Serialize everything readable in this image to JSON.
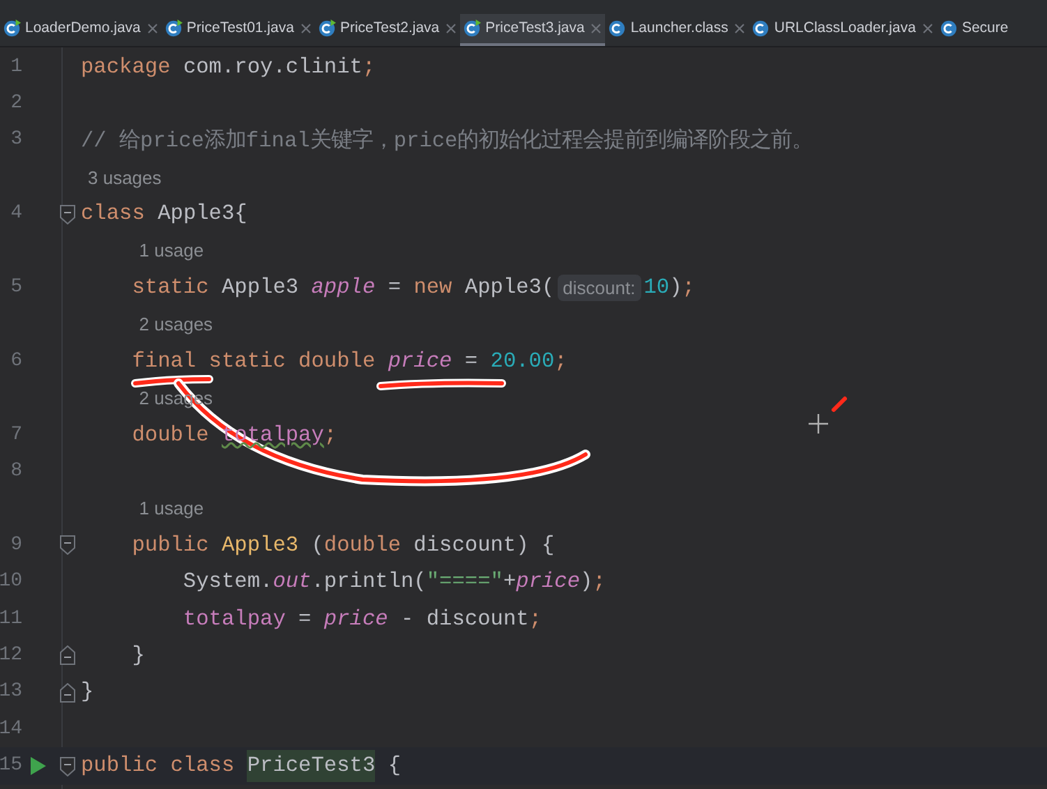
{
  "tabs": [
    {
      "label": "LoaderDemo.java",
      "kind": "runnable",
      "selected": false
    },
    {
      "label": "PriceTest01.java",
      "kind": "runnable",
      "selected": false
    },
    {
      "label": "PriceTest2.java",
      "kind": "runnable",
      "selected": false
    },
    {
      "label": "PriceTest3.java",
      "kind": "runnable",
      "selected": true
    },
    {
      "label": "Launcher.class",
      "kind": "class",
      "selected": false
    },
    {
      "label": "URLClassLoader.java",
      "kind": "class",
      "selected": false
    },
    {
      "label": "Secure",
      "kind": "class",
      "selected": false
    }
  ],
  "editor": {
    "rows": [
      {
        "kind": "code",
        "number": "1",
        "tokens": [
          {
            "text": "package",
            "kind": "keyword"
          },
          {
            "text": " com.roy.clinit",
            "kind": "plain"
          },
          {
            "text": ";",
            "kind": "keyword"
          }
        ]
      },
      {
        "kind": "code",
        "number": "2",
        "tokens": []
      },
      {
        "kind": "code",
        "number": "3",
        "tokens": [
          {
            "text": "// 给price添加final关键字，price的初始化过程会提前到编译阶段之前。",
            "kind": "comment"
          }
        ]
      },
      {
        "kind": "usage",
        "text": "3 usages"
      },
      {
        "kind": "code",
        "number": "4",
        "fold": {
          "kind": "start"
        },
        "tokens": [
          {
            "text": "class",
            "kind": "keyword"
          },
          {
            "text": " Apple3{",
            "kind": "plain"
          }
        ]
      },
      {
        "kind": "usage",
        "text": "1 usage"
      },
      {
        "kind": "code",
        "number": "5",
        "tokens": [
          {
            "text": "    static",
            "kind": "keyword"
          },
          {
            "text": " Apple3 ",
            "kind": "plain"
          },
          {
            "text": "apple",
            "kind": "static_field"
          },
          {
            "text": " = ",
            "kind": "plain"
          },
          {
            "text": "new",
            "kind": "keyword"
          },
          {
            "text": " Apple3(",
            "kind": "plain"
          },
          {
            "text": "discount:",
            "kind": "hint"
          },
          {
            "text": "10",
            "kind": "number"
          },
          {
            "text": ")",
            "kind": "plain"
          },
          {
            "text": ";",
            "kind": "keyword"
          }
        ]
      },
      {
        "kind": "usage",
        "text": "2 usages"
      },
      {
        "kind": "code",
        "number": "6",
        "tokens": [
          {
            "text": "    final static double ",
            "kind": "keyword"
          },
          {
            "text": "price",
            "kind": "static_field"
          },
          {
            "text": " = ",
            "kind": "plain"
          },
          {
            "text": "20.00",
            "kind": "number"
          },
          {
            "text": ";",
            "kind": "keyword"
          }
        ]
      },
      {
        "kind": "usage",
        "text": "2 usages"
      },
      {
        "kind": "code",
        "number": "7",
        "tokens": [
          {
            "text": "    double ",
            "kind": "keyword"
          },
          {
            "text": "totalpay",
            "kind": "warned_field"
          },
          {
            "text": ";",
            "kind": "keyword"
          }
        ]
      },
      {
        "kind": "code",
        "number": "8",
        "tokens": []
      },
      {
        "kind": "usage",
        "text": "1 usage"
      },
      {
        "kind": "code",
        "number": "9",
        "fold": {
          "kind": "start"
        },
        "tokens": [
          {
            "text": "    public ",
            "kind": "keyword"
          },
          {
            "text": "Apple3",
            "kind": "declaration"
          },
          {
            "text": " (",
            "kind": "plain"
          },
          {
            "text": "double",
            "kind": "keyword"
          },
          {
            "text": " discount) {",
            "kind": "plain"
          }
        ]
      },
      {
        "kind": "code",
        "number": "10",
        "tokens": [
          {
            "text": "        System.",
            "kind": "plain"
          },
          {
            "text": "out",
            "kind": "static_field"
          },
          {
            "text": ".println(",
            "kind": "plain"
          },
          {
            "text": "\"====\"",
            "kind": "string"
          },
          {
            "text": "+",
            "kind": "plain"
          },
          {
            "text": "price",
            "kind": "static_field"
          },
          {
            "text": ")",
            "kind": "plain"
          },
          {
            "text": ";",
            "kind": "keyword"
          }
        ]
      },
      {
        "kind": "code",
        "number": "11",
        "tokens": [
          {
            "text": "        totalpay",
            "kind": "field"
          },
          {
            "text": " = ",
            "kind": "plain"
          },
          {
            "text": "price",
            "kind": "static_field"
          },
          {
            "text": " - discount",
            "kind": "plain"
          },
          {
            "text": ";",
            "kind": "keyword"
          }
        ]
      },
      {
        "kind": "code",
        "number": "12",
        "fold": {
          "kind": "end"
        },
        "tokens": [
          {
            "text": "    }",
            "kind": "plain"
          }
        ]
      },
      {
        "kind": "code",
        "number": "13",
        "fold": {
          "kind": "end"
        },
        "tokens": [
          {
            "text": "}",
            "kind": "plain"
          }
        ]
      },
      {
        "kind": "code",
        "number": "14",
        "tokens": []
      },
      {
        "kind": "code",
        "number": "15",
        "fold": {
          "kind": "start"
        },
        "run": true,
        "current": true,
        "tokens": [
          {
            "text": "public class ",
            "kind": "keyword"
          },
          {
            "text": "PriceTest3",
            "kind": "highlighted"
          },
          {
            "text": " {",
            "kind": "plain"
          }
        ]
      }
    ]
  }
}
